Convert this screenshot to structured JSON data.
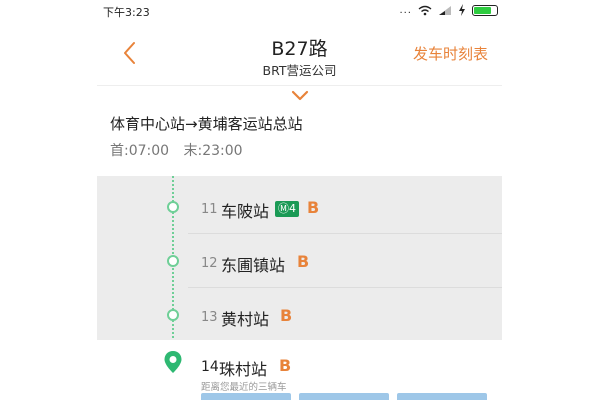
{
  "status_bar": {
    "time": "下午3:23",
    "dots": "...",
    "battery_level": 0.8
  },
  "header": {
    "title": "B27路",
    "subtitle": "BRT营运公司",
    "timetable_label": "发车时刻表"
  },
  "route": {
    "direction": "体育中心站→黄埔客运站总站",
    "first": "首:07:00",
    "last": "末:23:00"
  },
  "stops": [
    {
      "num": "11",
      "name": "车陂站",
      "metro": "4",
      "badge": "B"
    },
    {
      "num": "12",
      "name": "东圃镇站",
      "badge": "B"
    },
    {
      "num": "13",
      "name": "黄村站",
      "badge": "B"
    }
  ],
  "current_stop": {
    "num": "14",
    "name": "珠村站",
    "badge": "B",
    "hint": "距离您最近的三辆车"
  },
  "colors": {
    "accent": "#e8833a",
    "line": "#6fcf97",
    "metro": "#1a9a55"
  }
}
